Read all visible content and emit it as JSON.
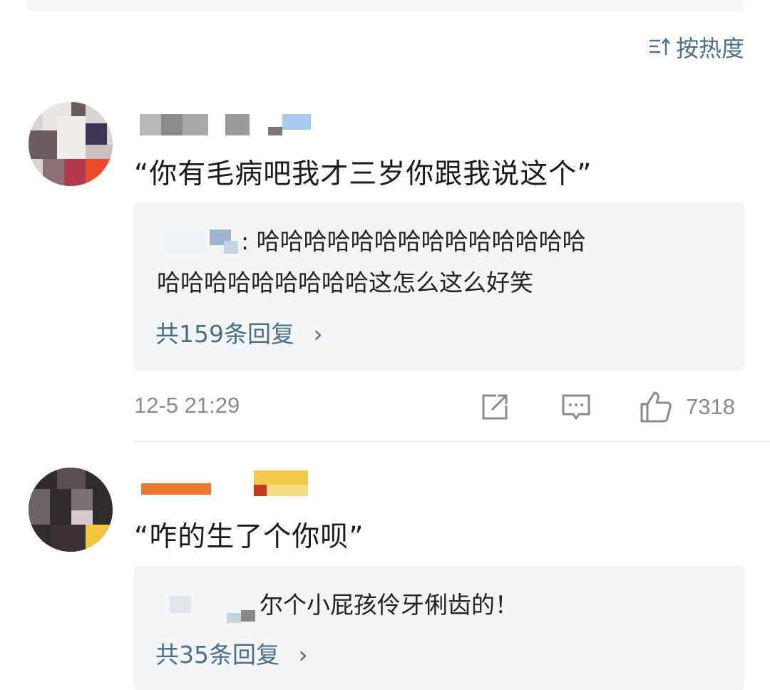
{
  "sort": {
    "label": "按热度",
    "icon": "sort-icon"
  },
  "comments": [
    {
      "text": "“你有毛病吧我才三岁你跟我说这个”",
      "reply": {
        "text_line1": ": 哈哈哈哈哈哈哈哈哈哈哈哈哈哈",
        "text_line2": "哈哈哈哈哈哈哈哈哈这怎么这么好笑",
        "count_label": "共159条回复",
        "chevron": "›"
      },
      "timestamp": "12-5 21:29",
      "likes": "7318",
      "icons": [
        "share-icon",
        "comment-icon",
        "like-icon"
      ]
    },
    {
      "text": "“咋的生了个你呗”",
      "reply": {
        "text_line1": "尔个小屁孩伶牙俐齿的！",
        "count_label": "共35条回复",
        "chevron": "›"
      }
    }
  ],
  "colors": {
    "link": "#4a6d8c",
    "meta": "#8a8a8a",
    "reply_bg": "#f4f5f7"
  }
}
